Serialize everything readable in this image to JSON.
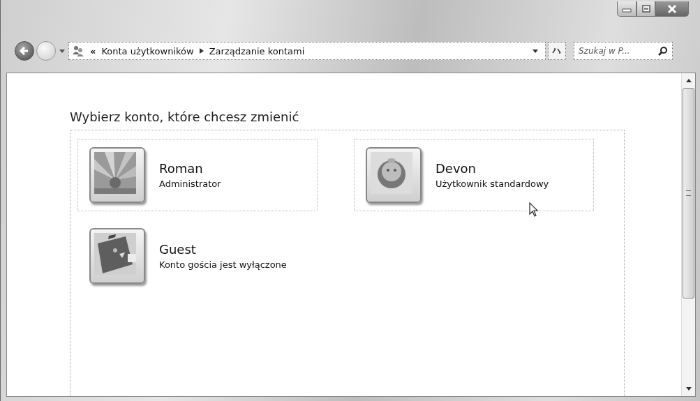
{
  "address_bar": {
    "overflow": "«",
    "breadcrumbs": [
      "Konta użytkowników",
      "Zarządzanie kontami"
    ],
    "search": {
      "placeholder": "Szukaj w P..."
    }
  },
  "heading": "Wybierz konto, które chcesz zmienić",
  "accounts": [
    {
      "name": "Roman",
      "description": "Administrator",
      "highlighted": true
    },
    {
      "name": "Devon",
      "description": "Użytkownik standardowy",
      "highlighted": true
    },
    {
      "name": "Guest",
      "description": "Konto gościa jest wyłączone",
      "highlighted": false
    }
  ]
}
